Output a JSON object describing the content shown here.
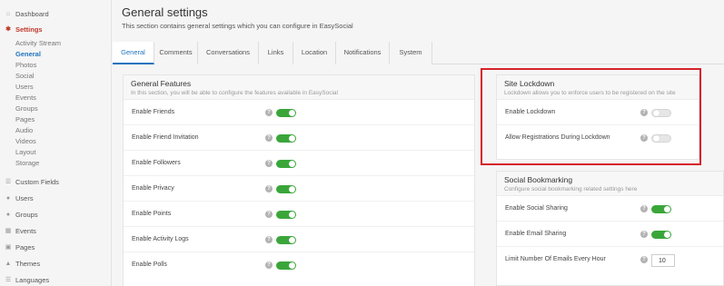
{
  "sidebar": {
    "items": [
      {
        "label": "Dashboard",
        "icon": "home-icon"
      },
      {
        "label": "Settings",
        "icon": "gear-icon"
      },
      {
        "label": "Custom Fields",
        "icon": "fields-icon"
      },
      {
        "label": "Users",
        "icon": "user-icon"
      },
      {
        "label": "Groups",
        "icon": "groups-icon"
      },
      {
        "label": "Events",
        "icon": "calendar-icon"
      },
      {
        "label": "Pages",
        "icon": "pages-icon"
      },
      {
        "label": "Themes",
        "icon": "themes-icon"
      },
      {
        "label": "Languages",
        "icon": "languages-icon"
      }
    ],
    "settings_subitems": [
      "Activity Stream",
      "General",
      "Photos",
      "Social",
      "Users",
      "Events",
      "Groups",
      "Pages",
      "Audio",
      "Videos",
      "Layout",
      "Storage"
    ]
  },
  "header": {
    "title": "General settings",
    "description": "This section contains general settings which you can configure in EasySocial"
  },
  "tabs": [
    "General",
    "Comments",
    "Conversations",
    "Links",
    "Location",
    "Notifications",
    "System"
  ],
  "general_features": {
    "title": "General Features",
    "subtitle": "In this section, you will be able to configure the features available in EasySocial",
    "rows": [
      {
        "label": "Enable Friends",
        "enabled": true
      },
      {
        "label": "Enable Friend Invitation",
        "enabled": true
      },
      {
        "label": "Enable Followers",
        "enabled": true
      },
      {
        "label": "Enable Privacy",
        "enabled": true
      },
      {
        "label": "Enable Points",
        "enabled": true
      },
      {
        "label": "Enable Activity Logs",
        "enabled": true
      },
      {
        "label": "Enable Polls",
        "enabled": true
      }
    ]
  },
  "site_lockdown": {
    "title": "Site Lockdown",
    "subtitle": "Lockdown allows you to enforce users to be registered on the site",
    "rows": [
      {
        "label": "Enable Lockdown",
        "enabled": false
      },
      {
        "label": "Allow Registrations During Lockdown",
        "enabled": false
      }
    ]
  },
  "social_bookmarking": {
    "title": "Social Bookmarking",
    "subtitle": "Configure social bookmarking related settings here",
    "rows": [
      {
        "label": "Enable Social Sharing",
        "enabled": true
      },
      {
        "label": "Enable Email Sharing",
        "enabled": true
      }
    ],
    "email_limit": {
      "label": "Limit Number Of Emails Every Hour",
      "value": "10"
    }
  },
  "help_glyph": "?",
  "colors": {
    "accent": "#1e73be",
    "active_nav": "#c0392b",
    "toggle_on": "#3aa63a",
    "highlight": "#d6222a"
  }
}
